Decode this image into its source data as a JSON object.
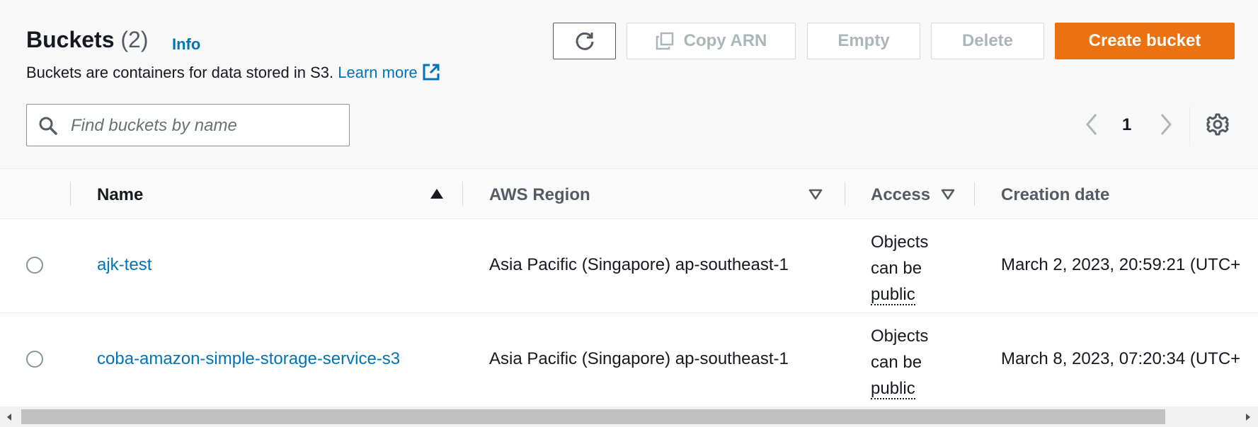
{
  "header": {
    "title": "Buckets",
    "count": "(2)",
    "info_link": "Info",
    "description": "Buckets are containers for data stored in S3.",
    "learn_more": "Learn more"
  },
  "toolbar": {
    "refresh_icon": "refresh-icon",
    "copy_arn_label": "Copy ARN",
    "copy_icon": "copy-icon",
    "empty_label": "Empty",
    "delete_label": "Delete",
    "create_label": "Create bucket"
  },
  "search": {
    "placeholder": "Find buckets by name",
    "value": ""
  },
  "pagination": {
    "current_page": "1"
  },
  "table": {
    "columns": [
      "Name",
      "AWS Region",
      "Access",
      "Creation date"
    ],
    "rows": [
      {
        "name": "ajk-test",
        "region": "Asia Pacific (Singapore) ap-southeast-1",
        "access_line1": "Objects",
        "access_line2": "can be",
        "access_line3": "public",
        "created": "March 2, 2023, 20:59:21 (UTC+"
      },
      {
        "name": "coba-amazon-simple-storage-service-s3",
        "region": "Asia Pacific (Singapore) ap-southeast-1",
        "access_line1": "Objects",
        "access_line2": "can be",
        "access_line3": "public",
        "created": "March 8, 2023, 07:20:34 (UTC+"
      }
    ]
  },
  "colors": {
    "primary": "#ec7211",
    "link": "#0073bb",
    "disabled_text": "#aab7b8"
  }
}
